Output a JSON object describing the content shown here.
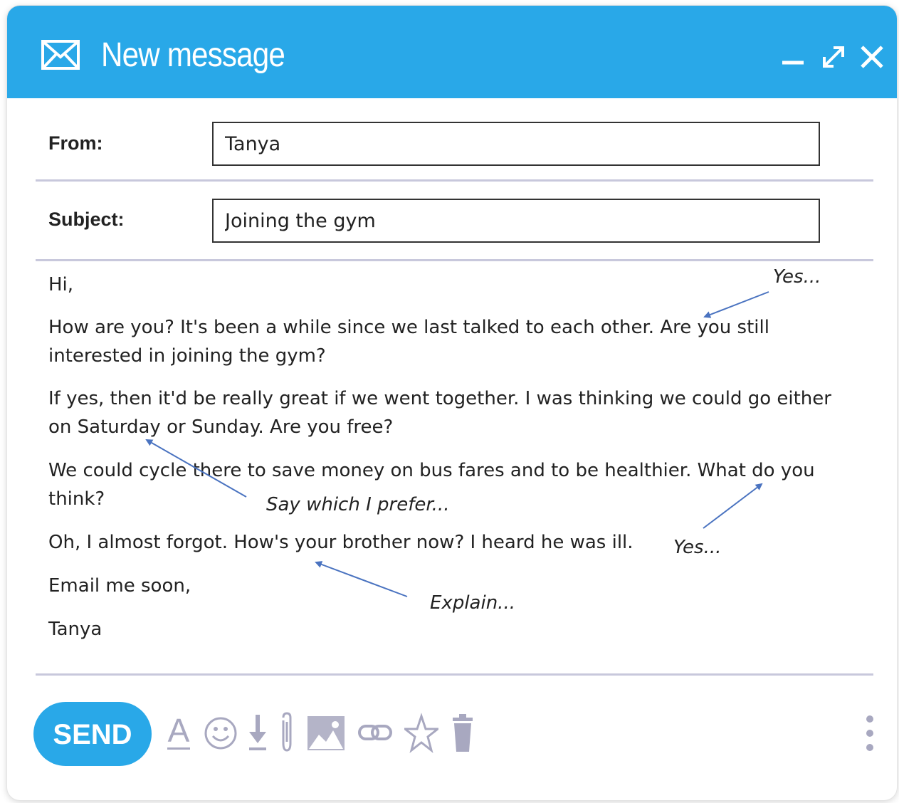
{
  "window": {
    "title": "New message",
    "accent_color": "#29a8e8",
    "controls": [
      "minimize-icon",
      "maximize-icon",
      "close-icon"
    ]
  },
  "form": {
    "from_label": "From:",
    "from_value": "Tanya",
    "subject_label": "Subject:",
    "subject_value": "Joining the gym"
  },
  "message": {
    "lines": [
      "Hi,",
      "How are you? It's been a while since we last talked to each other. Are you still",
      "interested in joining the gym?",
      "If yes, then it'd be really great if we went together. I was thinking we could go either",
      "on Saturday or Sunday. Are you free?",
      "We could cycle there to save money on bus fares and to be healthier. What do you",
      "think?",
      "Oh, I almost forgot. How's your brother now? I heard he was ill.",
      "Email me soon,",
      "Tanya"
    ]
  },
  "annotations": {
    "note1": "Yes...",
    "note2": "Say which I prefer...",
    "note3": "Yes...",
    "note4": "Explain..."
  },
  "toolbar": {
    "send_label": "SEND",
    "icons": [
      "text-format-icon",
      "emoji-icon",
      "download-icon",
      "attachment-icon",
      "image-icon",
      "link-icon",
      "star-icon",
      "trash-icon",
      "more-vertical-icon"
    ]
  }
}
